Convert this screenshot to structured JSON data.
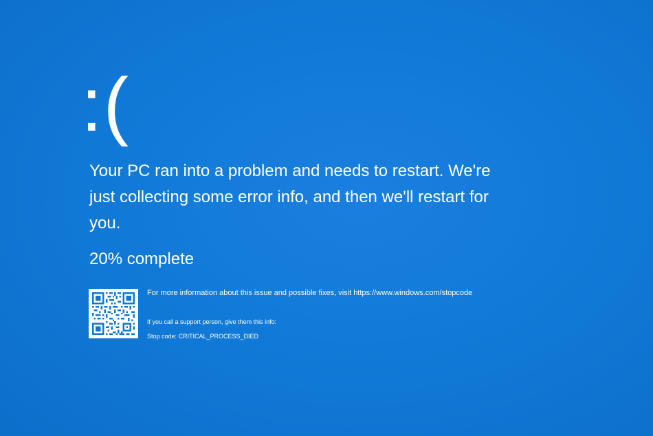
{
  "screen": {
    "background_color": "#0f78d5",
    "sad_face": ":(",
    "headline": "Your PC ran into a problem and needs to restart. We're just collecting some error info, and then we'll restart for you.",
    "progress": {
      "percent": 20,
      "text": "20% complete"
    },
    "more_info": "For more information about this issue and possible fixes, visit https://www.windows.com/stopcode",
    "support_text": "If you call a support person, give them this info:",
    "stop_code": "Stop code: CRITICAL_PROCESS_DIED",
    "qr_icon": "qr-code-icon"
  }
}
